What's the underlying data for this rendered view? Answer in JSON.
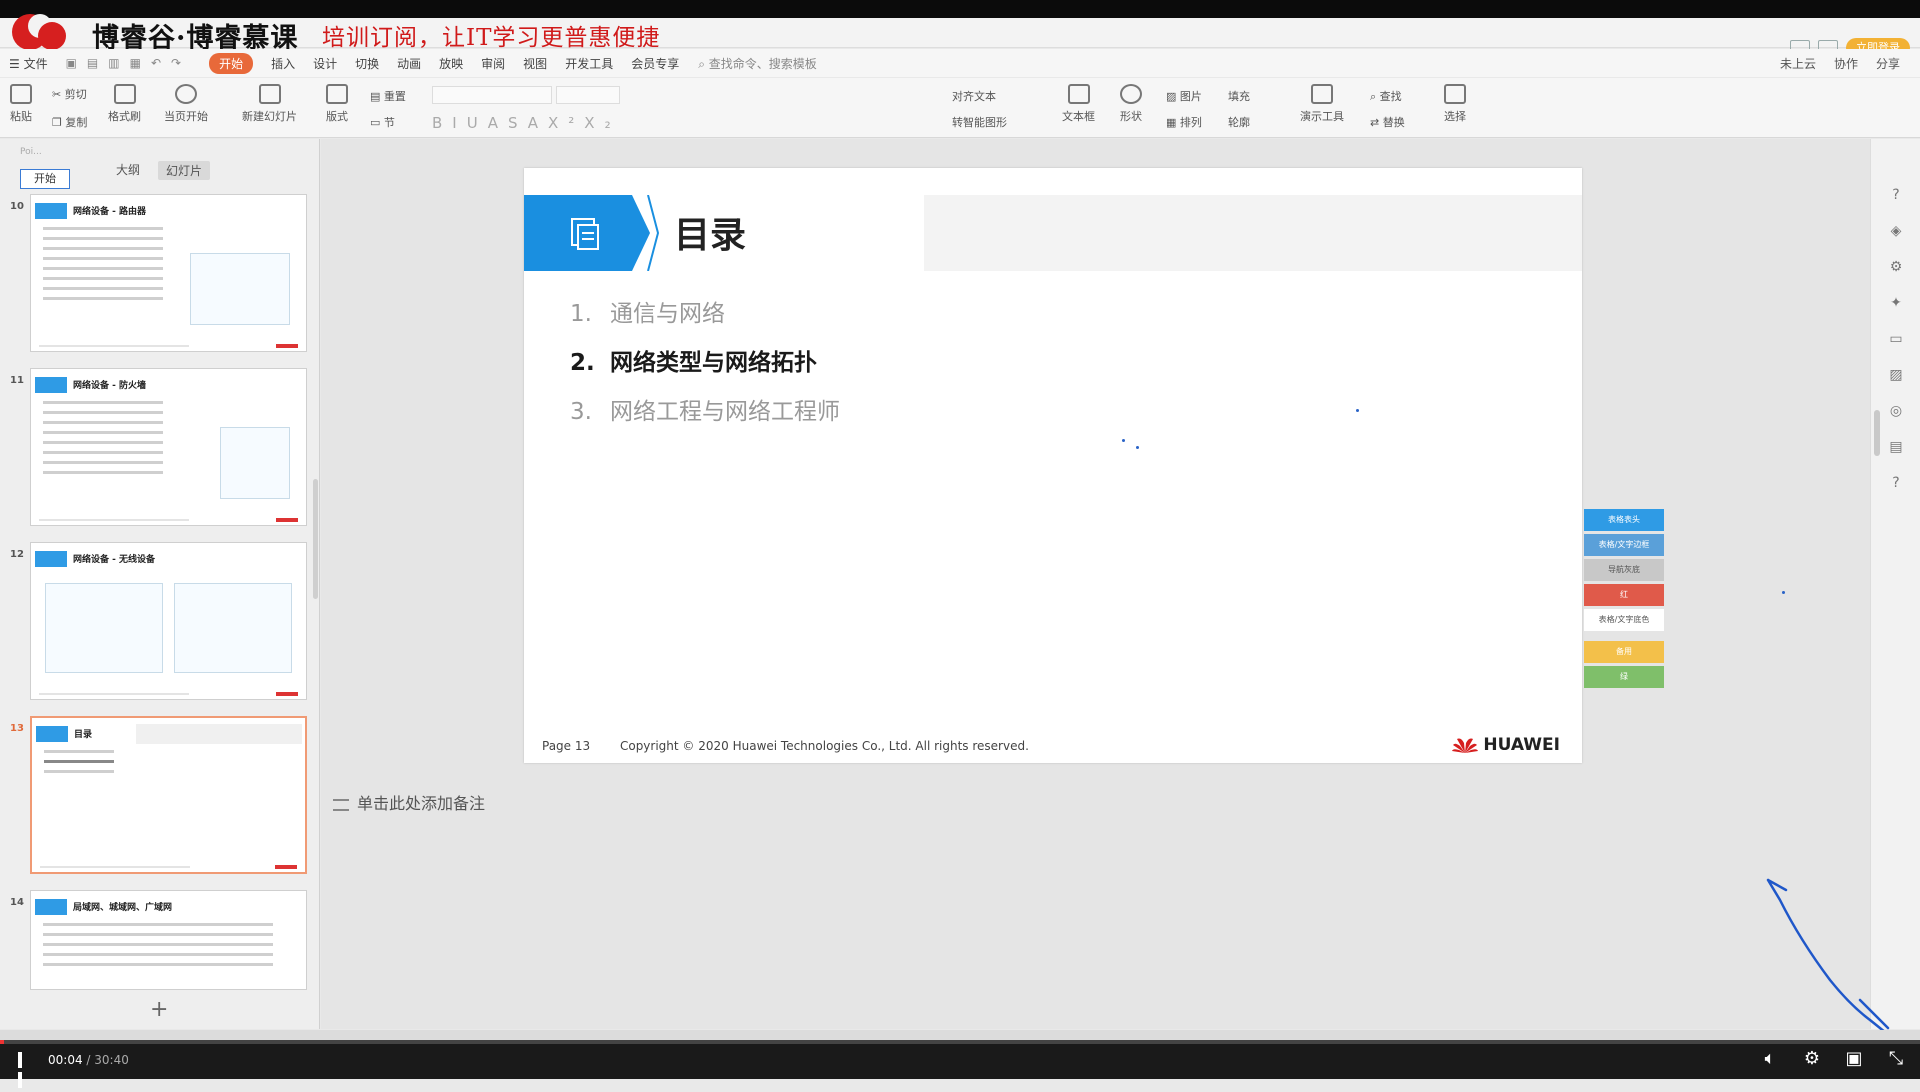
{
  "window": {
    "brand": "博睿谷·博睿慕课",
    "banner": "培训订阅，让IT学习更普惠便捷",
    "login_label": "立即登录"
  },
  "menu": {
    "file": "文件",
    "tabs": [
      "开始",
      "插入",
      "设计",
      "切换",
      "动画",
      "放映",
      "审阅",
      "视图",
      "开发工具",
      "会员专享"
    ],
    "active_tab": "开始",
    "search_placeholder": "查找命令、搜索模板",
    "right": [
      "未上云",
      "协作",
      "分享"
    ]
  },
  "ribbon": {
    "paste": "粘贴",
    "cut": "剪切",
    "copy": "复制",
    "format_painter": "格式刷",
    "play_from_current": "当页开始",
    "new_slide": "新建幻灯片",
    "layout": "版式",
    "reset": "重置",
    "section": "节",
    "align_text": "对齐文本",
    "convert_smartart": "转智能图形",
    "textbox": "文本框",
    "shape": "形状",
    "picture": "图片",
    "arrange": "排列",
    "fill": "填充",
    "outline": "轮廓",
    "present_tools": "演示工具",
    "find": "查找",
    "replace": "替换",
    "select": "选择"
  },
  "left_panel": {
    "poi": "Poi...",
    "start_button": "开始",
    "tabs": [
      "大纲",
      "幻灯片"
    ],
    "active_tab": "幻灯片",
    "thumbnails": [
      {
        "num": "10",
        "title": "网络设备 - 路由器"
      },
      {
        "num": "11",
        "title": "网络设备 - 防火墙"
      },
      {
        "num": "12",
        "title": "网络设备 - 无线设备"
      },
      {
        "num": "13",
        "title": "目录",
        "selected": true
      },
      {
        "num": "14",
        "title": "局域网、城域网、广域网"
      }
    ],
    "add_slide": "+"
  },
  "slide": {
    "title": "目录",
    "items": [
      {
        "num": "1.",
        "text": "通信与网络",
        "current": false
      },
      {
        "num": "2.",
        "text": "网络类型与网络拓扑",
        "current": true
      },
      {
        "num": "3.",
        "text": "网络工程与网络工程师",
        "current": false
      }
    ],
    "page": "Page 13",
    "copyright": "Copyright © 2020 Huawei Technologies Co., Ltd. All rights reserved.",
    "logo_text": "HUAWEI"
  },
  "palette": [
    {
      "label": "表格表头",
      "color": "#2f9be5"
    },
    {
      "label": "表格/文字边框",
      "color": "#5aa0d9"
    },
    {
      "label": "导航灰底",
      "color": "#c8c8c8"
    },
    {
      "label": "红",
      "color": "#e05a4a"
    },
    {
      "label": "表格/文字底色",
      "color": "#ffffff"
    },
    {
      "label": "备用",
      "color": "#f3c04a"
    },
    {
      "label": "绿",
      "color": "#7fbf6a"
    }
  ],
  "notes": {
    "placeholder": "单击此处添加备注"
  },
  "video": {
    "current_time": "00:04",
    "total_time": "/ 30:40",
    "progress_fraction": 0.002
  }
}
